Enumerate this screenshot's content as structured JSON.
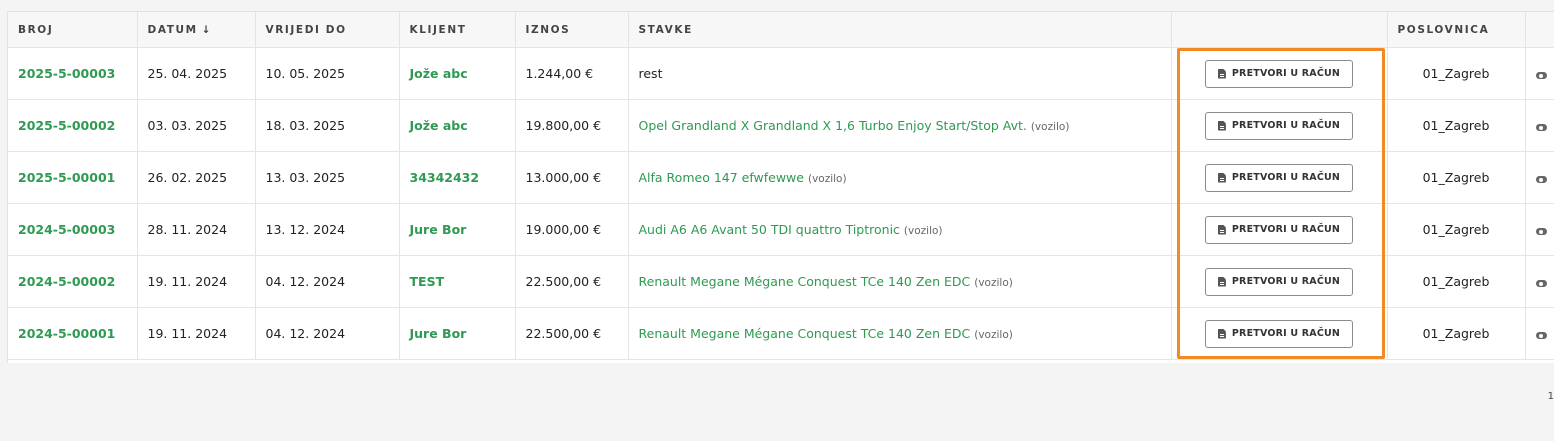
{
  "table": {
    "headers": {
      "broj": "BROJ",
      "datum": "DATUM",
      "sort_arrow": "↓",
      "vrijedi_do": "VRIJEDI DO",
      "klijent": "KLIJENT",
      "iznos": "IZNOS",
      "stavke": "STAVKE",
      "action": "",
      "poslovnica": "POSLOVNICA"
    },
    "rows": [
      {
        "broj": "2025-5-00003",
        "datum": "25. 04. 2025",
        "vrijedi_do": "10. 05. 2025",
        "klijent": "Jože abc",
        "iznos": "1.244,00 €",
        "stavka": "rest",
        "stavka_note": "",
        "button": "PRETVORI U RAČUN",
        "poslovnica": "01_Zagreb"
      },
      {
        "broj": "2025-5-00002",
        "datum": "03. 03. 2025",
        "vrijedi_do": "18. 03. 2025",
        "klijent": "Jože abc",
        "iznos": "19.800,00 €",
        "stavka": "Opel Grandland X Grandland X 1,6 Turbo Enjoy Start/Stop Avt.",
        "stavka_note": "(vozilo)",
        "button": "PRETVORI U RAČUN",
        "poslovnica": "01_Zagreb"
      },
      {
        "broj": "2025-5-00001",
        "datum": "26. 02. 2025",
        "vrijedi_do": "13. 03. 2025",
        "klijent": "34342432",
        "iznos": "13.000,00 €",
        "stavka": "Alfa Romeo 147 efwfewwe",
        "stavka_note": "(vozilo)",
        "button": "PRETVORI U RAČUN",
        "poslovnica": "01_Zagreb"
      },
      {
        "broj": "2024-5-00003",
        "datum": "28. 11. 2024",
        "vrijedi_do": "13. 12. 2024",
        "klijent": "Jure Bor",
        "iznos": "19.000,00 €",
        "stavka": "Audi A6 A6 Avant 50 TDI quattro Tiptronic",
        "stavka_note": "(vozilo)",
        "button": "PRETVORI U RAČUN",
        "poslovnica": "01_Zagreb"
      },
      {
        "broj": "2024-5-00002",
        "datum": "19. 11. 2024",
        "vrijedi_do": "04. 12. 2024",
        "klijent": "TEST",
        "iznos": "22.500,00 €",
        "stavka": "Renault Megane Mégane Conquest TCe 140 Zen EDC",
        "stavka_note": "(vozilo)",
        "button": "PRETVORI U RAČUN",
        "poslovnica": "01_Zagreb"
      },
      {
        "broj": "2024-5-00001",
        "datum": "19. 11. 2024",
        "vrijedi_do": "04. 12. 2024",
        "klijent": "Jure Bor",
        "iznos": "22.500,00 €",
        "stavka": "Renault Megane Mégane Conquest TCe 140 Zen EDC",
        "stavka_note": "(vozilo)",
        "button": "PRETVORI U RAČUN",
        "poslovnica": "01_Zagreb"
      }
    ]
  },
  "pagination": {
    "current_page": "1"
  },
  "colors": {
    "link": "#2e9a52",
    "highlight": "#f08a24"
  },
  "icons": {
    "button_icon": "document-icon",
    "row_action_icon": "eye-icon",
    "sort_icon": "arrow-down-icon"
  }
}
